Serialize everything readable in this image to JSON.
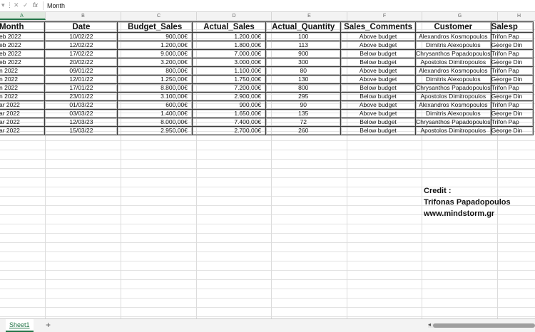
{
  "formula_bar": {
    "icons": [
      "cancel-icon",
      "check-icon",
      "function-icon"
    ],
    "cancel_glyph": "✕",
    "check_glyph": "✓",
    "fx_label": "fx",
    "content": "Month"
  },
  "column_headers": [
    "A",
    "B",
    "C",
    "D",
    "E",
    "F",
    "G",
    "H"
  ],
  "table": {
    "headers": [
      "Month",
      "Date",
      "Budget_Sales",
      "Actual_Sales",
      "Actual_Quantity",
      "Sales_Comments",
      "Customer",
      "Salesp"
    ],
    "rows": [
      [
        "eb 2022",
        "10/02/22",
        "900,00€",
        "1.200,00€",
        "100",
        "Above budget",
        "Alexandros Kosmopoulos",
        "Trifon Pap"
      ],
      [
        "eb 2022",
        "12/02/22",
        "1.200,00€",
        "1.800,00€",
        "113",
        "Above budget",
        "Dimitris Alexopoulos",
        "George Din"
      ],
      [
        "eb 2022",
        "17/02/22",
        "9.000,00€",
        "7.000,00€",
        "900",
        "Below budget",
        "Chrysanthos Papadopoulos",
        "Trifon Pap"
      ],
      [
        "eb 2022",
        "20/02/22",
        "3.200,00€",
        "3.000,00€",
        "300",
        "Below budget",
        "Apostolos Dimitropoulos",
        "George Din"
      ],
      [
        "n 2022",
        "09/01/22",
        "800,00€",
        "1.100,00€",
        "80",
        "Above budget",
        "Alexandros Kosmopoulos",
        "Trifon Pap"
      ],
      [
        "n 2022",
        "12/01/22",
        "1.250,00€",
        "1.750,00€",
        "130",
        "Above budget",
        "Dimitris Alexopoulos",
        "George Din"
      ],
      [
        "n 2022",
        "17/01/22",
        "8.800,00€",
        "7.200,00€",
        "800",
        "Below budget",
        "Chrysanthos Papadopoulos",
        "Trifon Pap"
      ],
      [
        "n 2022",
        "23/01/22",
        "3.100,00€",
        "2.900,00€",
        "295",
        "Below budget",
        "Apostolos Dimitropoulos",
        "George Din"
      ],
      [
        "ar 2022",
        "01/03/22",
        "600,00€",
        "900,00€",
        "90",
        "Above budget",
        "Alexandros Kosmopoulos",
        "Trifon Pap"
      ],
      [
        "ar 2022",
        "03/03/22",
        "1.400,00€",
        "1.650,00€",
        "135",
        "Above budget",
        "Dimitris Alexopoulos",
        "George Din"
      ],
      [
        "ar 2022",
        "12/03/23",
        "8.000,00€",
        "7.400,00€",
        "72",
        "Below budget",
        "Chrysanthos Papadopoulos",
        "Trifon Pap"
      ],
      [
        "ar 2022",
        "15/03/22",
        "2.950,00€",
        "2.700,00€",
        "260",
        "Below budget",
        "Apostolos Dimitropoulos",
        "George Din"
      ]
    ]
  },
  "credit": {
    "line1": "Credit :",
    "line2": "Trifonas Papadopoulos",
    "line3": "www.mindstorm.gr"
  },
  "tabs": {
    "sheet": "Sheet1",
    "add": "+",
    "scroll_left": "◂"
  },
  "colors": {
    "accent": "#217346",
    "border": "#3c3c3c"
  }
}
